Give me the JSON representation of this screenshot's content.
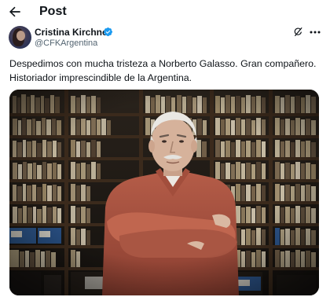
{
  "header": {
    "back_icon": "arrow-left-icon",
    "title": "Post"
  },
  "author": {
    "display_name": "Cristina Kirchner",
    "handle": "@CFKArgentina",
    "verified": true,
    "verified_color": "#1d9bf0",
    "grok_icon": "grok-icon",
    "more_icon": "more-horizontal-icon"
  },
  "tweet": {
    "lines": [
      "Despedimos con mucha tristeza a Norberto Galasso. Gran compañero.",
      "Historiador imprescindible de la Argentina."
    ]
  },
  "media": {
    "type": "photo"
  },
  "colors": {
    "text": "#0f1419",
    "secondary": "#536471",
    "accent": "#1d9bf0"
  }
}
